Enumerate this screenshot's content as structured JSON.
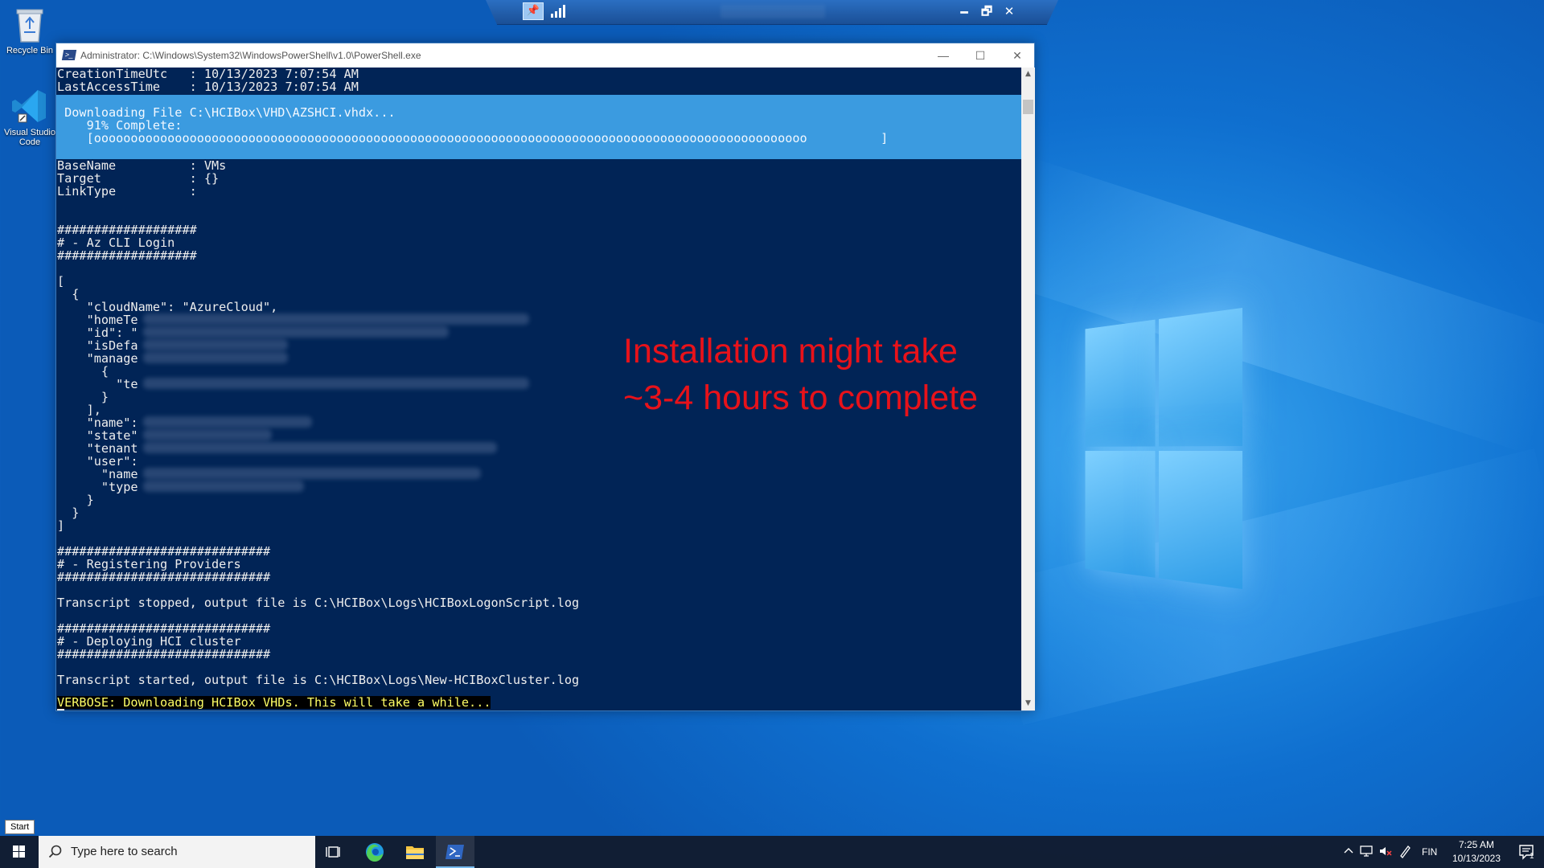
{
  "desktop": {
    "icons": [
      {
        "label": "Recycle Bin"
      },
      {
        "label": "Visual Studio Code"
      }
    ]
  },
  "rdp_bar": {
    "pin_label": "pin",
    "minimize": "🗕",
    "restore": "🗗",
    "close": "✕"
  },
  "powershell": {
    "title": "Administrator: C:\\Windows\\System32\\WindowsPowerShell\\v1.0\\PowerShell.exe",
    "controls": {
      "minimize": "—",
      "maximize": "☐",
      "close": "✕"
    },
    "lines_top": [
      "CreationTimeUtc   : 10/13/2023 7:07:54 AM",
      "LastAccessTime    : 10/13/2023 7:07:54 AM"
    ],
    "progress": {
      "activity": " Downloading File C:\\HCIBox\\VHD\\AZSHCI.vhdx...",
      "status": "    91% Complete:",
      "percent": 91,
      "bar": "    [ooooooooooooooooooooooooooooooooooooooooooooooooooooooooooooooooooooooooooooooooooooooooooooooooo          ]"
    },
    "lines_after": [
      "BaseName          : VMs",
      "Target            : {}",
      "LinkType          :",
      "",
      "",
      "###################",
      "# - Az CLI Login",
      "###################",
      "",
      "[",
      "  {",
      "    \"cloudName\": \"AzureCloud\",",
      "    \"homeTe",
      "    \"id\": \"",
      "    \"isDefa",
      "    \"manage",
      "      {",
      "        \"te",
      "      }",
      "    ],",
      "    \"name\":",
      "    \"state\"",
      "    \"tenant",
      "    \"user\":",
      "      \"name",
      "      \"type",
      "    }",
      "  }",
      "]",
      "",
      "#############################",
      "# - Registering Providers",
      "#############################",
      "",
      "Transcript stopped, output file is C:\\HCIBox\\Logs\\HCIBoxLogonScript.log",
      "",
      "#############################",
      "# - Deploying HCI cluster",
      "#############################",
      "",
      "Transcript started, output file is C:\\HCIBox\\Logs\\New-HCIBoxCluster.log"
    ],
    "verbose_line": "VERBOSE: Downloading HCIBox VHDs. This will take a while...",
    "scroll_up": "▲",
    "scroll_down": "▼"
  },
  "annotation": {
    "text": "Installation might take ~3-4 hours to complete",
    "color": "#e8121a"
  },
  "start_tooltip": "Start",
  "taskbar": {
    "search_placeholder": "Type here to search",
    "apps": [
      "task-view",
      "edge",
      "file-explorer",
      "powershell"
    ],
    "tray": {
      "language": "FIN",
      "time": "7:25 AM",
      "date": "10/13/2023",
      "notification_count": "1"
    }
  },
  "colors": {
    "console_bg": "#012456",
    "progress_bg": "#3b9be0",
    "verbose_fg": "#ffff66",
    "taskbar_bg": "#121c30"
  }
}
